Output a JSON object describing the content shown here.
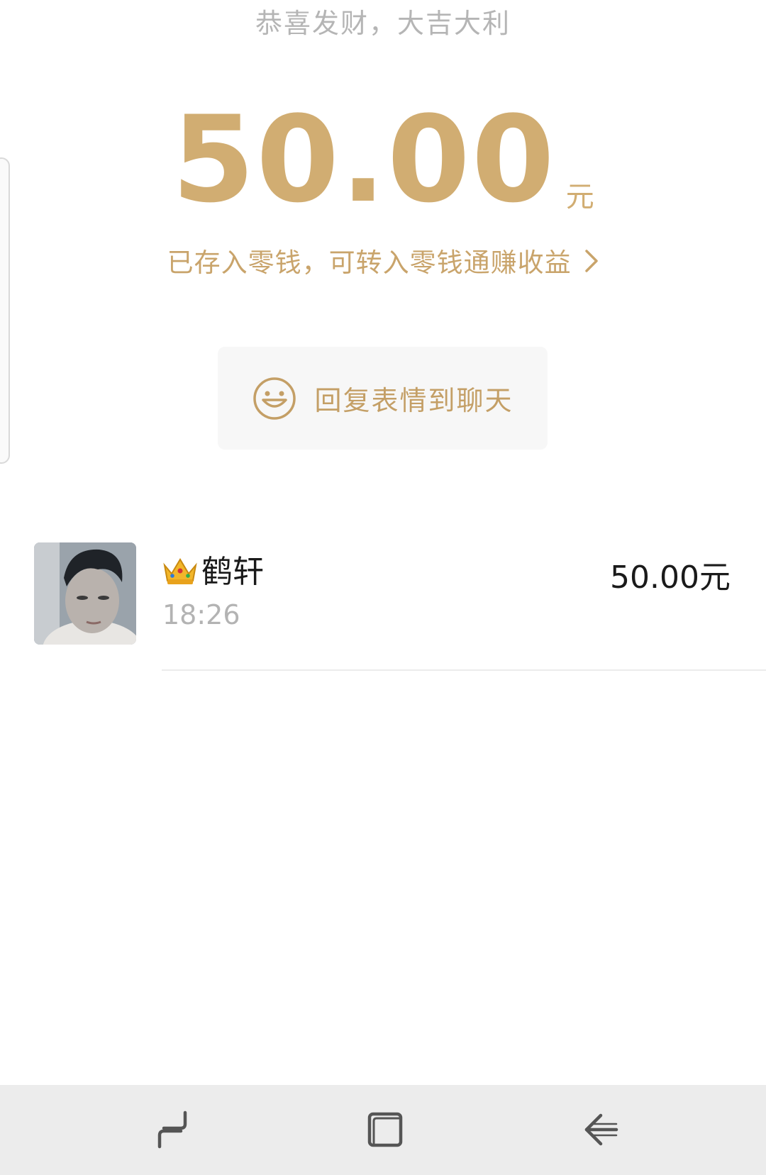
{
  "header": {
    "greeting": "恭喜发财，大吉大利"
  },
  "packet": {
    "amount": "50.00",
    "unit": "元",
    "wallet_link": "已存入零钱，可转入零钱通赚收益"
  },
  "reply_button": {
    "label": "回复表情到聊天"
  },
  "record": {
    "sender": "鹤轩",
    "time": "18:26",
    "amount": "50.00元"
  },
  "colors": {
    "gold": "#d1ad72",
    "gold_text": "#c49f66",
    "nav_bg": "#ececec"
  },
  "icons": {
    "back": "chevron-right-icon",
    "smile": "smile-icon",
    "crown": "crown-icon",
    "nav": [
      "recent-apps-icon",
      "home-icon",
      "back-icon"
    ]
  }
}
